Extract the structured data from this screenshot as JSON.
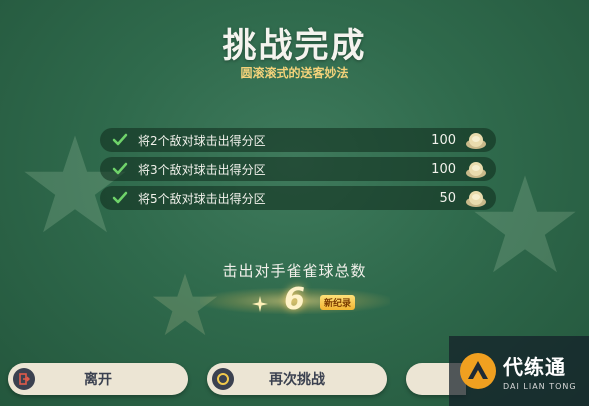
{
  "header": {
    "title": "挑战完成",
    "subtitle": "圆滚滚式的送客妙法"
  },
  "tasks": [
    {
      "label": "将2个敌对球击出得分区",
      "value": "100"
    },
    {
      "label": "将3个敌对球击出得分区",
      "value": "100"
    },
    {
      "label": "将5个敌对球击出得分区",
      "value": "50"
    }
  ],
  "result": {
    "total_label": "击出对手雀雀球总数",
    "score": "6",
    "new_record_badge": "新纪录"
  },
  "buttons": {
    "leave_label": "离开",
    "retry_label": "再次挑战"
  },
  "watermark": {
    "name_cn": "代练通",
    "name_en": "DAI LIAN TONG"
  },
  "colors": {
    "background": "#2f6a4c",
    "subtitle": "#f3d27a",
    "check": "#6fd36a",
    "button_bg": "#ece5d4",
    "button_text": "#3b4150"
  }
}
